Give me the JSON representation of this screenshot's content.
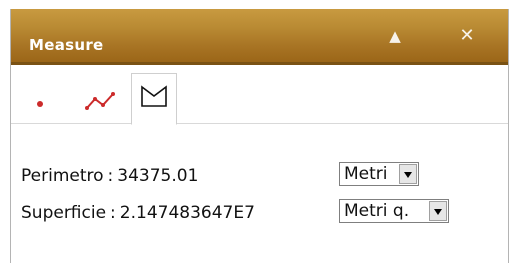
{
  "panel": {
    "title": "Measure",
    "collapse_glyph": "▲",
    "close_glyph": "✕"
  },
  "tabs": [
    {
      "name": "point",
      "icon": "point-icon",
      "selected": false
    },
    {
      "name": "line",
      "icon": "polyline-icon",
      "selected": false
    },
    {
      "name": "area",
      "icon": "polygon-icon",
      "selected": true
    }
  ],
  "results": {
    "perimeter": {
      "label": "Perimetro",
      "separator": ":",
      "value": "34375.01",
      "unit": "Metri"
    },
    "area": {
      "label": "Superficie",
      "separator": ":",
      "value": "2.147483647E7",
      "unit": "Metri q."
    }
  },
  "colors": {
    "titlebar": "#b08030",
    "point": "#cc2b2b",
    "line": "#cc2b2b"
  }
}
